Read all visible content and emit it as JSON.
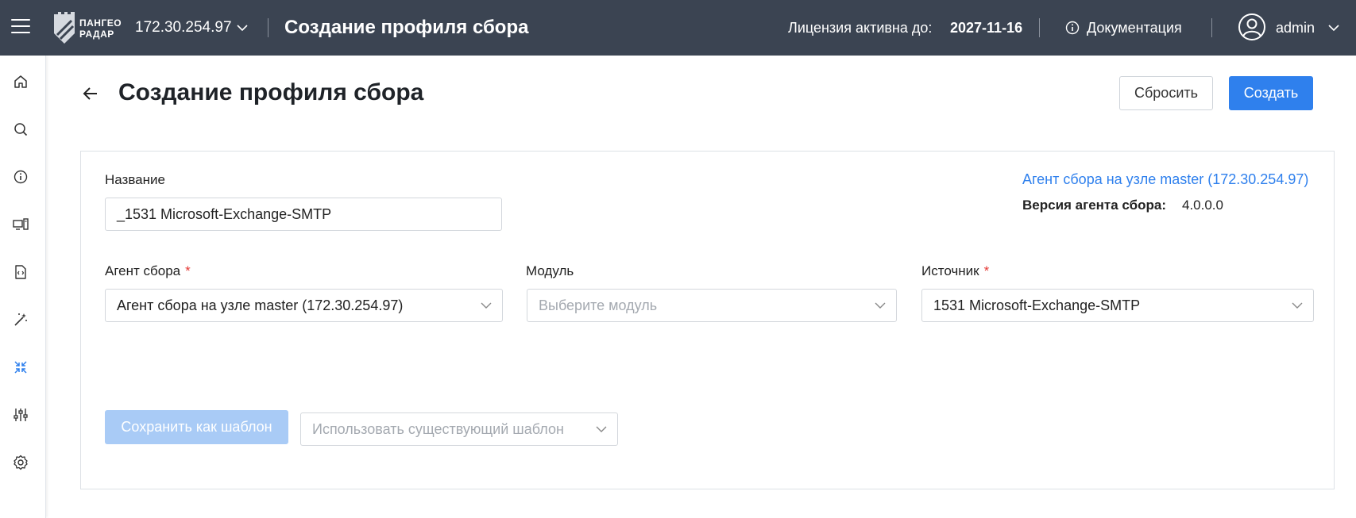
{
  "topbar": {
    "logo_line1": "ПАНГЕО",
    "logo_line2": "РАДАР",
    "host": "172.30.254.97",
    "title": "Создание профиля сбора",
    "license_label": "Лицензия активна до:",
    "license_date": "2027-11-16",
    "docs_label": "Документация",
    "user": "admin"
  },
  "sidebar": {
    "items": [
      {
        "icon": "home-icon"
      },
      {
        "icon": "search-icon"
      },
      {
        "icon": "info-icon"
      },
      {
        "icon": "devices-icon"
      },
      {
        "icon": "code-file-icon"
      },
      {
        "icon": "magic-wand-icon"
      },
      {
        "icon": "collapse-arrows-icon",
        "active": true
      },
      {
        "icon": "sliders-icon"
      },
      {
        "icon": "gear-icon"
      }
    ],
    "active_color": "#2f80ed"
  },
  "page": {
    "title": "Создание профиля сбора",
    "reset_label": "Сбросить",
    "create_label": "Создать"
  },
  "form": {
    "name_label": "Название",
    "name_value": "_1531 Microsoft-Exchange-SMTP",
    "agent_label": "Агент сбора",
    "agent_value": "Агент сбора на узле master (172.30.254.97)",
    "module_label": "Модуль",
    "module_placeholder": "Выберите модуль",
    "source_label": "Источник",
    "source_value": "1531 Microsoft-Exchange-SMTP",
    "required_mark": "*"
  },
  "info": {
    "agent_link": "Агент сбора на узле master (172.30.254.97)",
    "version_label": "Версия агента сбора:",
    "version_value": "4.0.0.0"
  },
  "footer": {
    "save_template_label": "Сохранить как шаблон",
    "use_template_placeholder": "Использовать существующий шаблон"
  },
  "colors": {
    "topbar_bg": "#3b4452",
    "primary": "#2f80ed",
    "primary_disabled": "#a9cbf6",
    "required": "#e53935"
  }
}
